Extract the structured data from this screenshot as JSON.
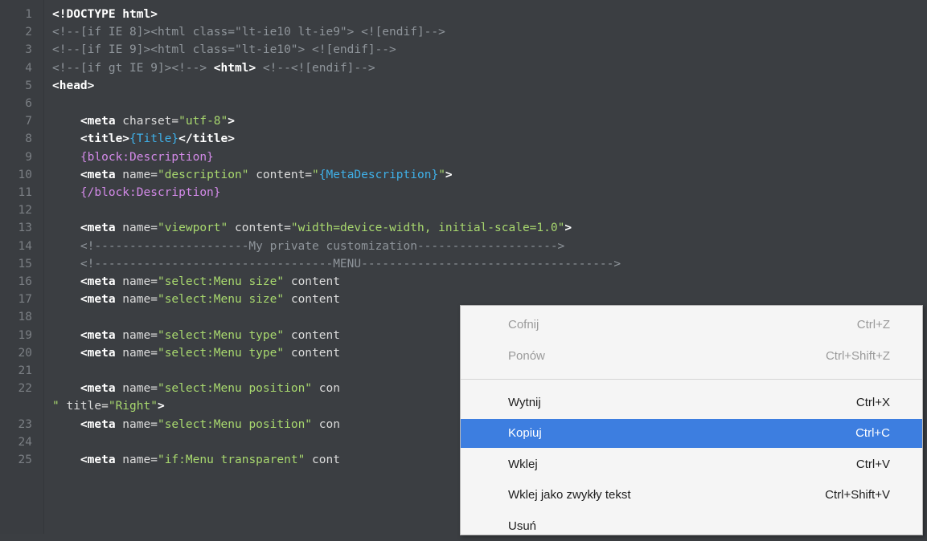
{
  "lines": [
    {
      "num": "1",
      "tokens": [
        {
          "c": "t-tag",
          "t": "<!DOCTYPE html>"
        }
      ]
    },
    {
      "num": "2",
      "tokens": [
        {
          "c": "t-cmt",
          "t": "<!--[if IE 8]><html class=\"lt-ie10 lt-ie9\"> <![endif]-->"
        }
      ]
    },
    {
      "num": "3",
      "tokens": [
        {
          "c": "t-cmt",
          "t": "<!--[if IE 9]><html class=\"lt-ie10\"> <![endif]-->"
        }
      ]
    },
    {
      "num": "4",
      "tokens": [
        {
          "c": "t-cmt",
          "t": "<!--[if gt IE 9]><!--> "
        },
        {
          "c": "t-tag",
          "t": "<html>"
        },
        {
          "c": "t-cmt",
          "t": " <!--<![endif]-->"
        }
      ]
    },
    {
      "num": "5",
      "tokens": [
        {
          "c": "t-tag",
          "t": "<head>"
        }
      ]
    },
    {
      "num": "6",
      "tokens": []
    },
    {
      "num": "7",
      "tokens": [
        {
          "c": "t-txt",
          "t": "    "
        },
        {
          "c": "t-tag",
          "t": "<meta"
        },
        {
          "c": "t-attr",
          "t": " charset="
        },
        {
          "c": "t-str",
          "t": "\"utf-8\""
        },
        {
          "c": "t-tag",
          "t": ">"
        }
      ]
    },
    {
      "num": "8",
      "tokens": [
        {
          "c": "t-txt",
          "t": "    "
        },
        {
          "c": "t-tag",
          "t": "<title>"
        },
        {
          "c": "t-var",
          "t": "{Title}"
        },
        {
          "c": "t-tag",
          "t": "</title>"
        }
      ]
    },
    {
      "num": "9",
      "tokens": [
        {
          "c": "t-txt",
          "t": "    "
        },
        {
          "c": "t-blk",
          "t": "{block:Description}"
        }
      ]
    },
    {
      "num": "10",
      "tokens": [
        {
          "c": "t-txt",
          "t": "    "
        },
        {
          "c": "t-tag",
          "t": "<meta"
        },
        {
          "c": "t-attr",
          "t": " name="
        },
        {
          "c": "t-str",
          "t": "\"description\""
        },
        {
          "c": "t-attr",
          "t": " content="
        },
        {
          "c": "t-str",
          "t": "\""
        },
        {
          "c": "t-var",
          "t": "{MetaDescription}"
        },
        {
          "c": "t-str",
          "t": "\""
        },
        {
          "c": "t-tag",
          "t": ">"
        }
      ]
    },
    {
      "num": "11",
      "tokens": [
        {
          "c": "t-txt",
          "t": "    "
        },
        {
          "c": "t-blk",
          "t": "{/block:Description}"
        }
      ]
    },
    {
      "num": "12",
      "tokens": []
    },
    {
      "num": "13",
      "tokens": [
        {
          "c": "t-txt",
          "t": "    "
        },
        {
          "c": "t-tag",
          "t": "<meta"
        },
        {
          "c": "t-attr",
          "t": " name="
        },
        {
          "c": "t-str",
          "t": "\"viewport\""
        },
        {
          "c": "t-attr",
          "t": " content="
        },
        {
          "c": "t-str",
          "t": "\"width=device-width, initial-scale=1.0\""
        },
        {
          "c": "t-tag",
          "t": ">"
        }
      ]
    },
    {
      "num": "14",
      "tokens": [
        {
          "c": "t-txt",
          "t": "    "
        },
        {
          "c": "t-cmt",
          "t": "<!----------------------My private customization-------------------->"
        }
      ]
    },
    {
      "num": "15",
      "tokens": [
        {
          "c": "t-txt",
          "t": "    "
        },
        {
          "c": "t-cmt",
          "t": "<!----------------------------------MENU------------------------------------>"
        }
      ]
    },
    {
      "num": "16",
      "tokens": [
        {
          "c": "t-txt",
          "t": "    "
        },
        {
          "c": "t-tag",
          "t": "<meta"
        },
        {
          "c": "t-attr",
          "t": " name="
        },
        {
          "c": "t-str",
          "t": "\"select:Menu size\""
        },
        {
          "c": "t-attr",
          "t": " content"
        }
      ]
    },
    {
      "num": "17",
      "tokens": [
        {
          "c": "t-txt",
          "t": "    "
        },
        {
          "c": "t-tag",
          "t": "<meta"
        },
        {
          "c": "t-attr",
          "t": " name="
        },
        {
          "c": "t-str",
          "t": "\"select:Menu size\""
        },
        {
          "c": "t-attr",
          "t": " content"
        }
      ]
    },
    {
      "num": "18",
      "tokens": []
    },
    {
      "num": "19",
      "tokens": [
        {
          "c": "t-txt",
          "t": "    "
        },
        {
          "c": "t-tag",
          "t": "<meta"
        },
        {
          "c": "t-attr",
          "t": " name="
        },
        {
          "c": "t-str",
          "t": "\"select:Menu type\""
        },
        {
          "c": "t-attr",
          "t": " content"
        }
      ]
    },
    {
      "num": "20",
      "tokens": [
        {
          "c": "t-txt",
          "t": "    "
        },
        {
          "c": "t-tag",
          "t": "<meta"
        },
        {
          "c": "t-attr",
          "t": " name="
        },
        {
          "c": "t-str",
          "t": "\"select:Menu type\""
        },
        {
          "c": "t-attr",
          "t": " content"
        }
      ]
    },
    {
      "num": "21",
      "tokens": []
    },
    {
      "num": "22",
      "tokens": [
        {
          "c": "t-txt",
          "t": "    "
        },
        {
          "c": "t-tag",
          "t": "<meta"
        },
        {
          "c": "t-attr",
          "t": " name="
        },
        {
          "c": "t-str",
          "t": "\"select:Menu position\""
        },
        {
          "c": "t-attr",
          "t": " con"
        }
      ]
    },
    {
      "num": "",
      "tokens": [
        {
          "c": "t-str",
          "t": "\""
        },
        {
          "c": "t-attr",
          "t": " title="
        },
        {
          "c": "t-str",
          "t": "\"Right\""
        },
        {
          "c": "t-tag",
          "t": ">"
        }
      ]
    },
    {
      "num": "23",
      "tokens": [
        {
          "c": "t-txt",
          "t": "    "
        },
        {
          "c": "t-tag",
          "t": "<meta"
        },
        {
          "c": "t-attr",
          "t": " name="
        },
        {
          "c": "t-str",
          "t": "\"select:Menu position\""
        },
        {
          "c": "t-attr",
          "t": " con"
        }
      ]
    },
    {
      "num": "24",
      "tokens": []
    },
    {
      "num": "25",
      "tokens": [
        {
          "c": "t-txt",
          "t": "    "
        },
        {
          "c": "t-tag",
          "t": "<meta"
        },
        {
          "c": "t-attr",
          "t": " name="
        },
        {
          "c": "t-str",
          "t": "\"if:Menu transparent\""
        },
        {
          "c": "t-attr",
          "t": " cont"
        }
      ]
    }
  ],
  "context_menu": {
    "items": [
      {
        "label": "Cofnij",
        "shortcut": "Ctrl+Z",
        "state": "disabled"
      },
      {
        "label": "Ponów",
        "shortcut": "Ctrl+Shift+Z",
        "state": "disabled"
      },
      {
        "label": "Wytnij",
        "shortcut": "Ctrl+X",
        "state": "enabled"
      },
      {
        "label": "Kopiuj",
        "shortcut": "Ctrl+C",
        "state": "hover"
      },
      {
        "label": "Wklej",
        "shortcut": "Ctrl+V",
        "state": "enabled"
      },
      {
        "label": "Wklej jako zwykły tekst",
        "shortcut": "Ctrl+Shift+V",
        "state": "enabled"
      },
      {
        "label": "Usuń",
        "shortcut": "",
        "state": "enabled"
      }
    ]
  },
  "colors": {
    "editor_bg": "#3b3e42",
    "tag": "#ffffff",
    "string": "#a8d86e",
    "comment": "#8f959b",
    "variable": "#3fb0e8",
    "block": "#d38ae8",
    "menu_highlight": "#3d7ee0"
  }
}
